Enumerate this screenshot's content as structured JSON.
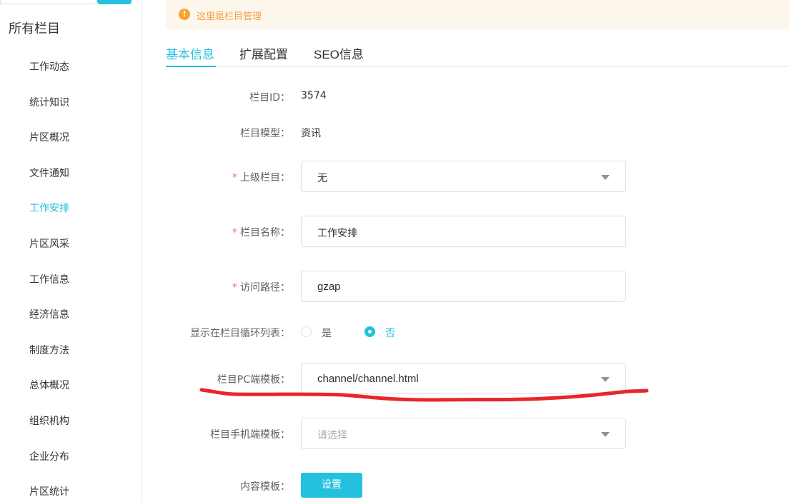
{
  "sidebar": {
    "title": "所有栏目",
    "items": [
      {
        "label": "工作动态"
      },
      {
        "label": "统计知识"
      },
      {
        "label": "片区概况"
      },
      {
        "label": "文件通知"
      },
      {
        "label": "工作安排",
        "active": true
      },
      {
        "label": "片区风采"
      },
      {
        "label": "工作信息"
      },
      {
        "label": "经济信息"
      },
      {
        "label": "制度方法"
      },
      {
        "label": "总体概况"
      },
      {
        "label": "组织机构"
      },
      {
        "label": "企业分布"
      },
      {
        "label": "片区统计"
      }
    ]
  },
  "alert": {
    "icon": "warning-icon",
    "text": "这里是栏目管理"
  },
  "tabs": [
    {
      "label": "基本信息",
      "active": true
    },
    {
      "label": "扩展配置"
    },
    {
      "label": "SEO信息"
    }
  ],
  "form": {
    "column_id": {
      "label": "栏目ID：",
      "value": "3574"
    },
    "column_model": {
      "label": "栏目模型：",
      "value": "资讯"
    },
    "parent_column": {
      "required": "*",
      "label": "上级栏目：",
      "value": "无"
    },
    "column_name": {
      "required": "*",
      "label": "栏目名称：",
      "value": "工作安排"
    },
    "access_path": {
      "required": "*",
      "label": "访问路径：",
      "value": "gzap"
    },
    "show_in_loop": {
      "label": "显示在栏目循环列表：",
      "options": [
        "是",
        "否"
      ],
      "selected": "否"
    },
    "pc_template": {
      "label": "栏目PC端模板：",
      "value": "channel/channel.html"
    },
    "mobile_template": {
      "label": "栏目手机端模板：",
      "placeholder": "请选择"
    },
    "content_template": {
      "label": "内容模板：",
      "button": "设置"
    }
  },
  "colors": {
    "accent": "#24c1de",
    "annotation": "#e8262c",
    "warning": "#f7a52e",
    "required": "#f56c6c"
  }
}
